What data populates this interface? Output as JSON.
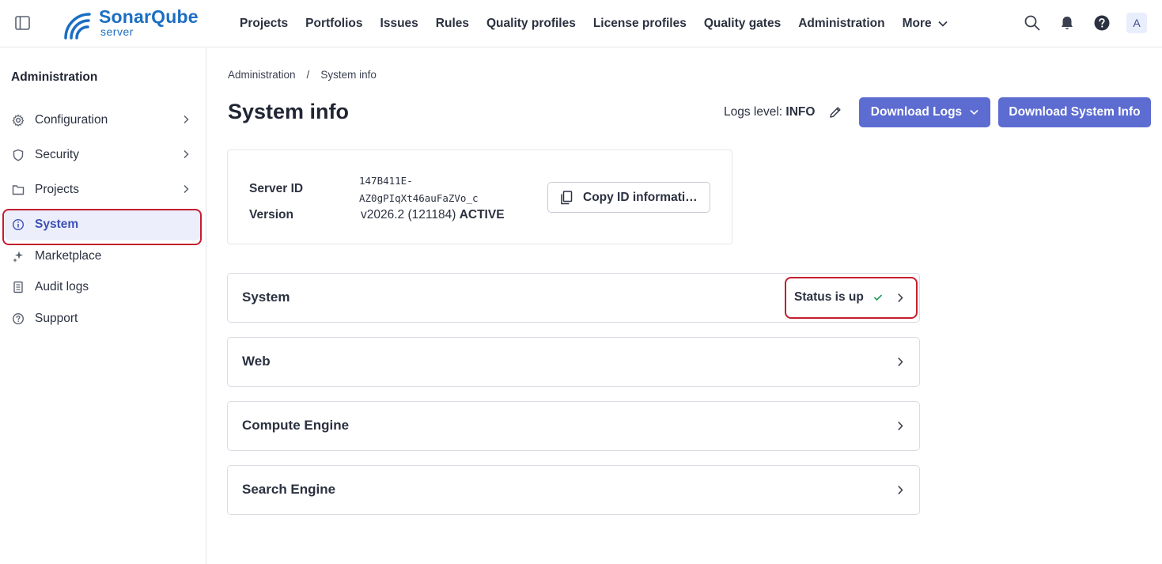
{
  "header": {
    "logo_text": "SonarQube",
    "logo_sub": "server",
    "nav": [
      "Projects",
      "Portfolios",
      "Issues",
      "Rules",
      "Quality profiles",
      "License profiles",
      "Quality gates",
      "Administration",
      "More"
    ],
    "avatar_letter": "A",
    "icons": [
      "sidebar-toggle-icon",
      "search-icon",
      "bell-icon",
      "help-icon"
    ]
  },
  "sidebar": {
    "title": "Administration",
    "items": [
      {
        "label": "Configuration",
        "icon": "gear-icon",
        "has_chevron": true
      },
      {
        "label": "Security",
        "icon": "shield-icon",
        "has_chevron": true
      },
      {
        "label": "Projects",
        "icon": "folder-icon",
        "has_chevron": true
      },
      {
        "label": "System",
        "icon": "info-icon",
        "has_chevron": false,
        "active": true
      },
      {
        "label": "Marketplace",
        "icon": "sparkle-icon",
        "has_chevron": false
      },
      {
        "label": "Audit logs",
        "icon": "document-icon",
        "has_chevron": false
      },
      {
        "label": "Support",
        "icon": "help-circle-icon",
        "has_chevron": false
      }
    ]
  },
  "breadcrumb": {
    "root": "Administration",
    "separator": "/",
    "current": "System info"
  },
  "page": {
    "title": "System info",
    "logs_level_label": "Logs level:",
    "logs_level_value": "INFO",
    "download_logs": "Download Logs",
    "download_system_info": "Download System Info"
  },
  "server": {
    "server_id_label": "Server ID",
    "server_id_line1": "147B411E-",
    "server_id_line2": "AZ0gPIqXt46auFaZVo_c",
    "version_label": "Version",
    "version_value": "v2026.2 (121184)",
    "version_status": "ACTIVE",
    "copy_button": "Copy ID informati…"
  },
  "sections": [
    {
      "title": "System",
      "status": "Status is up"
    },
    {
      "title": "Web"
    },
    {
      "title": "Compute Engine"
    },
    {
      "title": "Search Engine"
    }
  ],
  "colors": {
    "primary": "#5d6cd1",
    "brand": "#1b6ec2",
    "highlight": "#c41e2f",
    "status_ok": "#1f9d55"
  }
}
